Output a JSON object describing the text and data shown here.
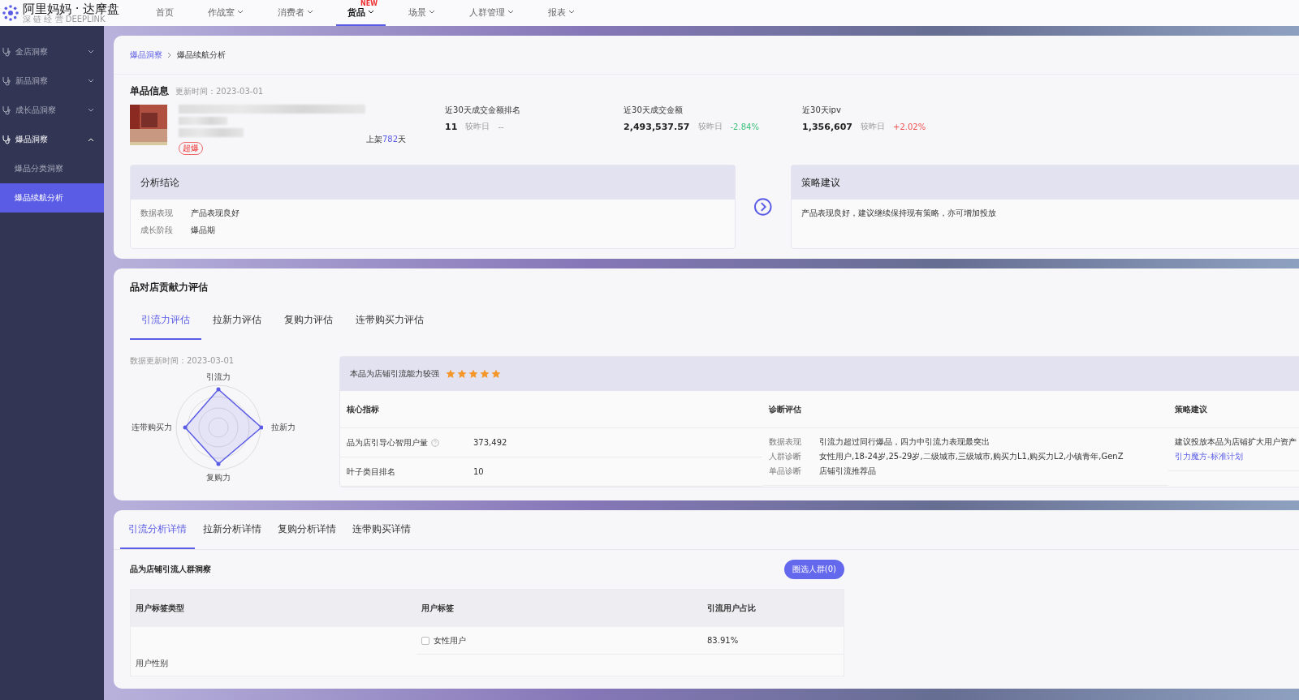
{
  "logo": {
    "title": "阿里妈妈 · 达摩盘",
    "subtitle": "深 链 经 营  DEEPLINK"
  },
  "nav": [
    {
      "label": "首页",
      "dropdown": false,
      "selected": false
    },
    {
      "label": "作战室",
      "dropdown": true,
      "selected": false
    },
    {
      "label": "消费者",
      "dropdown": true,
      "selected": false
    },
    {
      "label": "货品",
      "dropdown": true,
      "selected": true,
      "badge": "NEW"
    },
    {
      "label": "场景",
      "dropdown": true,
      "selected": false
    },
    {
      "label": "人群管理",
      "dropdown": true,
      "selected": false
    },
    {
      "label": "报表",
      "dropdown": true,
      "selected": false
    }
  ],
  "sidebar": [
    {
      "label": "全店洞察",
      "expanded": false
    },
    {
      "label": "新品洞察",
      "expanded": false
    },
    {
      "label": "成长品洞察",
      "expanded": false
    },
    {
      "label": "爆品洞察",
      "expanded": true,
      "children": [
        {
          "label": "爆品分类洞察",
          "selected": false
        },
        {
          "label": "爆品续航分析",
          "selected": true
        }
      ]
    }
  ],
  "breadcrumb": [
    {
      "label": "爆品洞察",
      "kind": "link"
    },
    {
      "label": "爆品续航分析",
      "kind": "current"
    }
  ],
  "product": {
    "title": "单品信息",
    "updated": "更新时间：2023-03-01",
    "listed_prefix": "上架",
    "listed_days": "782",
    "listed_suffix": "天",
    "tag": "超爆",
    "metrics": [
      {
        "label": "近30天成交金额排名",
        "value": "11",
        "compare_label": "较昨日",
        "change": "--",
        "color": "#999999"
      },
      {
        "label": "近30天成交金额",
        "value": "2,493,537.57",
        "compare_label": "较昨日",
        "change": "-2.84%",
        "color": "#3cbf7a"
      },
      {
        "label": "近30天ipv",
        "value": "1,356,607",
        "compare_label": "较昨日",
        "change": "+2.02%",
        "color": "#f05050"
      }
    ]
  },
  "conclusion": {
    "title": "分析结论",
    "rows": [
      {
        "label": "数据表现",
        "value": "产品表现良好"
      },
      {
        "label": "成长阶段",
        "value": "爆品期"
      }
    ]
  },
  "strategy": {
    "title": "策略建议",
    "text": "产品表现良好，建议继续保持现有策略，亦可增加投放"
  },
  "contribution": {
    "title": "品对店贡献力评估",
    "tabs": [
      {
        "label": "引流力评估",
        "selected": true
      },
      {
        "label": "拉新力评估",
        "selected": false
      },
      {
        "label": "复购力评估",
        "selected": false
      },
      {
        "label": "连带购买力评估",
        "selected": false
      }
    ],
    "updated": "数据更新时间：2023-03-01",
    "radar_labels": [
      "引流力",
      "拉新力",
      "复购力",
      "连带购买力"
    ],
    "summary": "本品为店铺引流能力较强",
    "stars": 5,
    "columns": [
      "核心指标",
      "诊断评估",
      "策略建议"
    ],
    "metrics": [
      {
        "label": "品为店引导心智用户量",
        "value": "373,492",
        "help": true
      },
      {
        "label": "叶子类目排名",
        "value": "10",
        "help": false
      }
    ],
    "diagnosis": [
      {
        "label": "数据表现",
        "value": "引流力超过同行爆品，四力中引流力表现最突出"
      },
      {
        "label": "人群诊断",
        "value": "女性用户,18-24岁,25-29岁,二级城市,三级城市,购买力L1,购买力L2,小镇青年,GenZ"
      },
      {
        "label": "单品诊断",
        "value": "店铺引流推荐品"
      }
    ],
    "advice": [
      {
        "text": "建议投放本品为店铺扩大用户资产",
        "kind": "text"
      },
      {
        "text": "引力魔方-标准计划",
        "kind": "link"
      }
    ]
  },
  "details": {
    "tabs": [
      {
        "label": "引流分析详情",
        "selected": true
      },
      {
        "label": "拉新分析详情",
        "selected": false
      },
      {
        "label": "复购分析详情",
        "selected": false
      },
      {
        "label": "连带购买详情",
        "selected": false
      }
    ],
    "section_title": "品为店铺引流人群洞察",
    "button": "圈选人群(0)",
    "columns": [
      "用户标签类型",
      "用户标签",
      "引流用户占比"
    ],
    "rows": [
      {
        "type": "用户性别",
        "tag": "女性用户",
        "checked": false,
        "share": "83.91%"
      }
    ]
  }
}
